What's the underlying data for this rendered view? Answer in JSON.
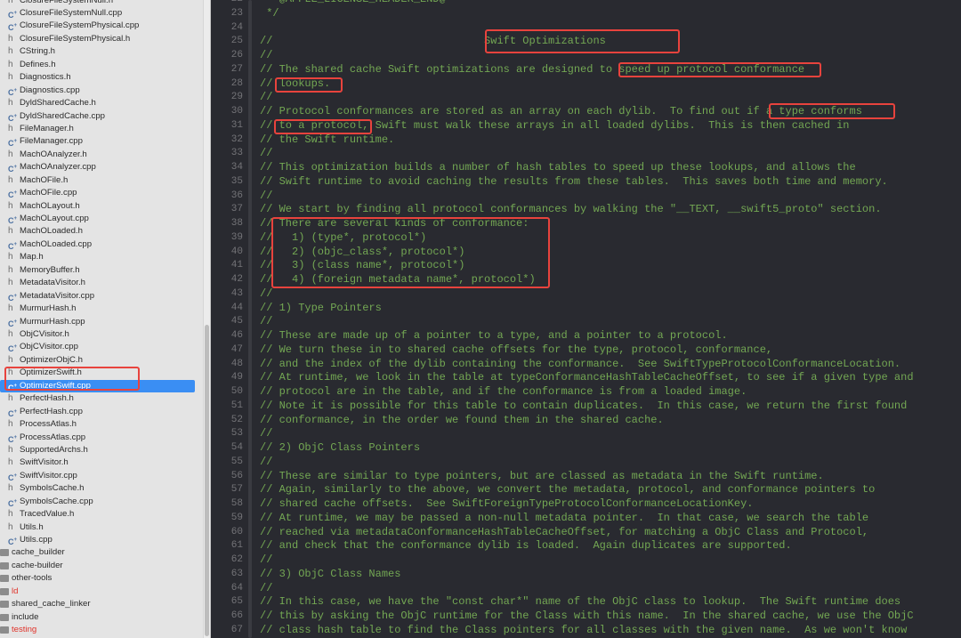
{
  "sidebar": {
    "files": [
      {
        "name": "ClosureFileSystemNull.h",
        "type": "h"
      },
      {
        "name": "ClosureFileSystemNull.cpp",
        "type": "cpp"
      },
      {
        "name": "ClosureFileSystemPhysical.cpp",
        "type": "cpp"
      },
      {
        "name": "ClosureFileSystemPhysical.h",
        "type": "h"
      },
      {
        "name": "CString.h",
        "type": "h"
      },
      {
        "name": "Defines.h",
        "type": "h"
      },
      {
        "name": "Diagnostics.h",
        "type": "h"
      },
      {
        "name": "Diagnostics.cpp",
        "type": "cpp"
      },
      {
        "name": "DyldSharedCache.h",
        "type": "h"
      },
      {
        "name": "DyldSharedCache.cpp",
        "type": "cpp"
      },
      {
        "name": "FileManager.h",
        "type": "h"
      },
      {
        "name": "FileManager.cpp",
        "type": "cpp"
      },
      {
        "name": "MachOAnalyzer.h",
        "type": "h"
      },
      {
        "name": "MachOAnalyzer.cpp",
        "type": "cpp"
      },
      {
        "name": "MachOFile.h",
        "type": "h"
      },
      {
        "name": "MachOFile.cpp",
        "type": "cpp"
      },
      {
        "name": "MachOLayout.h",
        "type": "h"
      },
      {
        "name": "MachOLayout.cpp",
        "type": "cpp"
      },
      {
        "name": "MachOLoaded.h",
        "type": "h"
      },
      {
        "name": "MachOLoaded.cpp",
        "type": "cpp"
      },
      {
        "name": "Map.h",
        "type": "h"
      },
      {
        "name": "MemoryBuffer.h",
        "type": "h"
      },
      {
        "name": "MetadataVisitor.h",
        "type": "h"
      },
      {
        "name": "MetadataVisitor.cpp",
        "type": "cpp"
      },
      {
        "name": "MurmurHash.h",
        "type": "h"
      },
      {
        "name": "MurmurHash.cpp",
        "type": "cpp"
      },
      {
        "name": "ObjCVisitor.h",
        "type": "h"
      },
      {
        "name": "ObjCVisitor.cpp",
        "type": "cpp"
      },
      {
        "name": "OptimizerObjC.h",
        "type": "h"
      },
      {
        "name": "OptimizerSwift.h",
        "type": "h"
      },
      {
        "name": "OptimizerSwift.cpp",
        "type": "cpp",
        "selected": true
      },
      {
        "name": "PerfectHash.h",
        "type": "h"
      },
      {
        "name": "PerfectHash.cpp",
        "type": "cpp"
      },
      {
        "name": "ProcessAtlas.h",
        "type": "h"
      },
      {
        "name": "ProcessAtlas.cpp",
        "type": "cpp"
      },
      {
        "name": "SupportedArchs.h",
        "type": "h"
      },
      {
        "name": "SwiftVisitor.h",
        "type": "h"
      },
      {
        "name": "SwiftVisitor.cpp",
        "type": "cpp"
      },
      {
        "name": "SymbolsCache.h",
        "type": "h"
      },
      {
        "name": "SymbolsCache.cpp",
        "type": "cpp"
      },
      {
        "name": "TracedValue.h",
        "type": "h"
      },
      {
        "name": "Utils.h",
        "type": "h"
      },
      {
        "name": "Utils.cpp",
        "type": "cpp"
      }
    ],
    "folders": [
      {
        "name": "cache_builder",
        "red": false
      },
      {
        "name": "cache-builder",
        "red": false
      },
      {
        "name": "other-tools",
        "red": false
      },
      {
        "name": "ld",
        "red": true
      },
      {
        "name": "shared_cache_linker",
        "red": false
      },
      {
        "name": "include",
        "red": false
      },
      {
        "name": "testing",
        "red": true
      }
    ],
    "icons": {
      "h": "h",
      "cpp": "C"
    }
  },
  "editor": {
    "first_line": 22,
    "comment_color": "#73a753",
    "highlight_color": "#e8433d",
    "lines": [
      " * @APPLE_LICENSE_HEADER_END@",
      " */",
      "",
      "//                                 Swift Optimizations",
      "//",
      "// The shared cache Swift optimizations are designed to speed up protocol conformance",
      "// lookups.",
      "//",
      "// Protocol conformances are stored as an array on each dylib.  To find out if a type conforms",
      "// to a protocol, Swift must walk these arrays in all loaded dylibs.  This is then cached in",
      "// the Swift runtime.",
      "//",
      "// This optimization builds a number of hash tables to speed up these lookups, and allows the",
      "// Swift runtime to avoid caching the results from these tables.  This saves both time and memory.",
      "//",
      "// We start by finding all protocol conformances by walking the \"__TEXT, __swift5_proto\" section.",
      "// There are several kinds of conformance:",
      "//   1) (type*, protocol*)",
      "//   2) (objc_class*, protocol*)",
      "//   3) (class name*, protocol*)",
      "//   4) (foreign metadata name*, protocol*)",
      "//",
      "// 1) Type Pointers",
      "//",
      "// These are made up of a pointer to a type, and a pointer to a protocol.",
      "// We turn these in to shared cache offsets for the type, protocol, conformance,",
      "// and the index of the dylib containing the conformance.  See SwiftTypeProtocolConformanceLocation.",
      "// At runtime, we look in the table at typeConformanceHashTableCacheOffset, to see if a given type and",
      "// protocol are in the table, and if the conformance is from a loaded image.",
      "// Note it is possible for this table to contain duplicates.  In this case, we return the first found",
      "// conformance, in the order we found them in the shared cache.",
      "//",
      "// 2) ObjC Class Pointers",
      "//",
      "// These are similar to type pointers, but are classed as metadata in the Swift runtime.",
      "// Again, similarly to the above, we convert the metadata, protocol, and conformance pointers to",
      "// shared cache offsets.  See SwiftForeignTypeProtocolConformanceLocationKey.",
      "// At runtime, we may be passed a non-null metadata pointer.  In that case, we search the table",
      "// reached via metadataConformanceHashTableCacheOffset, for matching a ObjC Class and Protocol,",
      "// and check that the conformance dylib is loaded.  Again duplicates are supported.",
      "//",
      "// 3) ObjC Class Names",
      "//",
      "// In this case, we have the \"const char*\" name of the ObjC class to lookup.  The Swift runtime does",
      "// this by asking the ObjC runtime for the Class with this name.  In the shared cache, we use the ObjC",
      "// class hash table to find the Class pointers for all classes with the given name.  As we won't know"
    ]
  }
}
